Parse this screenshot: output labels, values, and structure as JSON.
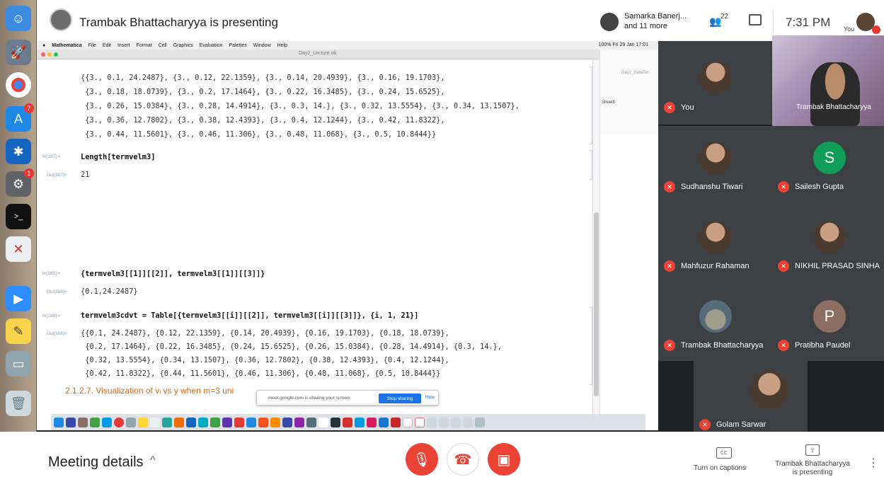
{
  "meet": {
    "presenting_banner": "Trambak Bhattacharyya is presenting",
    "viewer_name_line1": "Samarka Banerj...",
    "viewer_name_line2": "and 11 more",
    "people_count": "22",
    "clock": "7:31 PM",
    "you_label": "You"
  },
  "mac": {
    "menubar": [
      "Mathematica",
      "File",
      "Edit",
      "Insert",
      "Format",
      "Cell",
      "Graphics",
      "Evaluation",
      "Palettes",
      "Window",
      "Help"
    ],
    "status": "100% Fri 29 Jan 17:01",
    "window_title": "Day2_Lecture.nb",
    "background_window_title": "Day2_DataTer",
    "background_sheet": "Sheet5"
  },
  "notebook": {
    "out_list_lines": [
      "{{3., 0.1, 24.2487}, {3., 0.12, 22.1359}, {3., 0.14, 20.4939}, {3., 0.16, 19.1703},",
      " {3., 0.18, 18.0739}, {3., 0.2, 17.1464}, {3., 0.22, 16.3485}, {3., 0.24, 15.6525},",
      " {3., 0.26, 15.0384}, {3., 0.28, 14.4914}, {3., 0.3, 14.}, {3., 0.32, 13.5554}, {3., 0.34, 13.1507},",
      " {3., 0.36, 12.7802}, {3., 0.38, 12.4393}, {3., 0.4, 12.1244}, {3., 0.42, 11.8322},",
      " {3., 0.44, 11.5601}, {3., 0.46, 11.306}, {3., 0.48, 11.068}, {3., 0.5, 10.8444}}"
    ],
    "in187_label": "In[187]:=",
    "in187": "Length[termvelm3]",
    "out187_label": "Out[187]=",
    "out187": "21",
    "in189_label": "In[189]:=",
    "in189": "{termvelm3[[1]][[2]], termvelm3[[1]][[3]]}",
    "out189_label": "Out[189]=",
    "out189": "{0.1,24.2487}",
    "in188_label": "In[188]:=",
    "in188": "termvelm3cdvt = Table[{termvelm3[[i]][[2]], termvelm3[[i]][[3]]}, {i, 1, 21}]",
    "out188_label": "Out[188]=",
    "out188_lines": [
      "{{0.1, 24.2487}, {0.12, 22.1359}, {0.14, 20.4939}, {0.16, 19.1703}, {0.18, 18.0739},",
      " {0.2, 17.1464}, {0.22, 16.3485}, {0.24, 15.6525}, {0.26, 15.0384}, {0.28, 14.4914}, {0.3, 14.},",
      " {0.32, 13.5554}, {0.34, 13.1507}, {0.36, 12.7802}, {0.38, 12.4393}, {0.4, 12.1244},",
      " {0.42, 11.8322}, {0.44, 11.5601}, {0.46, 11.306}, {0.48, 11.068}, {0.5, 10.8444}}"
    ],
    "section": "2.1.2.7. Visualization of vᵢ vs y when m=3 uni",
    "share_banner_text": "meet.google.com is sharing your screen.",
    "stop_sharing": "Stop sharing",
    "hide": "Hide"
  },
  "participants": [
    {
      "name": "You",
      "type": "photo"
    },
    {
      "name": "Trambak Bhattacharyya",
      "type": "video"
    },
    {
      "name": "Sudhanshu Tiwari",
      "type": "photo"
    },
    {
      "name": "Sailesh Gupta",
      "type": "letter",
      "letter": "S",
      "color": "#0f9d58"
    },
    {
      "name": "Mahfuzur Rahaman",
      "type": "photo"
    },
    {
      "name": "NIKHIL PRASAD SINHA",
      "type": "photo"
    },
    {
      "name": "Trambak Bhattacharyya",
      "type": "photo"
    },
    {
      "name": "Pratibha Paudel",
      "type": "letter",
      "letter": "P",
      "color": "#8d6e63"
    },
    {
      "name": "Golam Sarwar",
      "type": "photo"
    }
  ],
  "bottom": {
    "meeting_details": "Meeting details",
    "captions_icon": "CC",
    "captions": "Turn on captions",
    "presenting_line1": "Trambak Bhattacharyya",
    "presenting_line2": "is presenting"
  },
  "colors": {
    "danger": "#ea4335",
    "accent": "#1a73e8",
    "panel_bg": "#202124",
    "tile_bg": "#3c4043"
  }
}
